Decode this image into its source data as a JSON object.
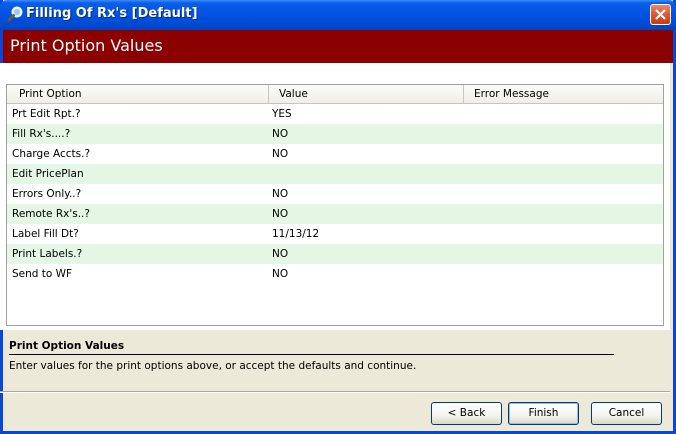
{
  "window": {
    "title": "Filling Of Rx's [Default]",
    "title_icon": "search-icon",
    "close_icon": "close-icon"
  },
  "banner": {
    "title": "Print Option Values",
    "color": "#8b0000"
  },
  "grid": {
    "columns": [
      "Print Option",
      "Value",
      "Error Message"
    ],
    "row_alt_color": "#e4f7e4",
    "rows": [
      {
        "option": "Prt Edit Rpt.?",
        "value": "YES",
        "error": ""
      },
      {
        "option": "Fill Rx's....?",
        "value": "NO",
        "error": ""
      },
      {
        "option": "Charge Accts.?",
        "value": "NO",
        "error": ""
      },
      {
        "option": "Edit PricePlan",
        "value": "",
        "error": ""
      },
      {
        "option": "Errors Only..?",
        "value": "NO",
        "error": ""
      },
      {
        "option": "Remote Rx's..?",
        "value": "NO",
        "error": ""
      },
      {
        "option": "Label Fill Dt?",
        "value": "11/13/12",
        "error": ""
      },
      {
        "option": "Print Labels.?",
        "value": "NO",
        "error": ""
      },
      {
        "option": "Send to WF",
        "value": "NO",
        "error": ""
      }
    ]
  },
  "description": {
    "title": "Print Option Values",
    "text": "Enter values for the print options above, or accept the defaults and continue."
  },
  "buttons": {
    "back": "< Back",
    "finish": "Finish",
    "cancel": "Cancel"
  }
}
